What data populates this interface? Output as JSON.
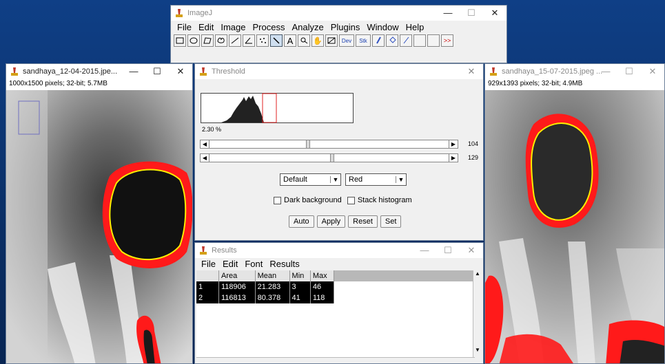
{
  "imagej": {
    "title": "ImageJ",
    "menu": [
      "File",
      "Edit",
      "Image",
      "Process",
      "Analyze",
      "Plugins",
      "Window",
      "Help"
    ],
    "tools": [
      "rectangle-tool-icon",
      "oval-tool-icon",
      "polygon-tool-icon",
      "freehand-tool-icon",
      "line-tool-icon",
      "angle-tool-icon",
      "multipoint-tool-icon",
      "wand-tool-icon",
      "text-tool-icon",
      "magnifier-tool-icon",
      "scroll-tool-icon",
      "color-picker-icon"
    ],
    "dev_label": "Dev",
    "stk_label": "Stk",
    "more_label": ">>"
  },
  "left_image": {
    "title": "sandhaya_12-04-2015.jpe...",
    "info": "1000x1500 pixels; 32-bit; 5.7MB"
  },
  "right_image": {
    "title": "sandhaya_15-07-2015.jpeg ...",
    "info": "929x1393 pixels; 32-bit; 4.9MB"
  },
  "threshold": {
    "title": "Threshold",
    "percent": "2.30 %",
    "min_value": "104",
    "max_value": "129",
    "min_fraction": 0.4,
    "max_fraction": 0.49,
    "method": "Default",
    "mode": "Red",
    "dark_background_label": "Dark background",
    "stack_histogram_label": "Stack histogram",
    "buttons": [
      "Auto",
      "Apply",
      "Reset",
      "Set"
    ]
  },
  "results": {
    "title": "Results",
    "menu": [
      "File",
      "Edit",
      "Font",
      "Results"
    ],
    "columns": [
      "",
      "Area",
      "Mean",
      "Min",
      "Max"
    ],
    "rows": [
      [
        "1",
        "118906",
        "21.283",
        "3",
        "46"
      ],
      [
        "2",
        "116813",
        "80.378",
        "41",
        "118"
      ]
    ]
  },
  "colors": {
    "threshold_red": "#ff1a1a",
    "outline_yellow": "#ffee00",
    "desktop_blue": "#0f3f86"
  }
}
